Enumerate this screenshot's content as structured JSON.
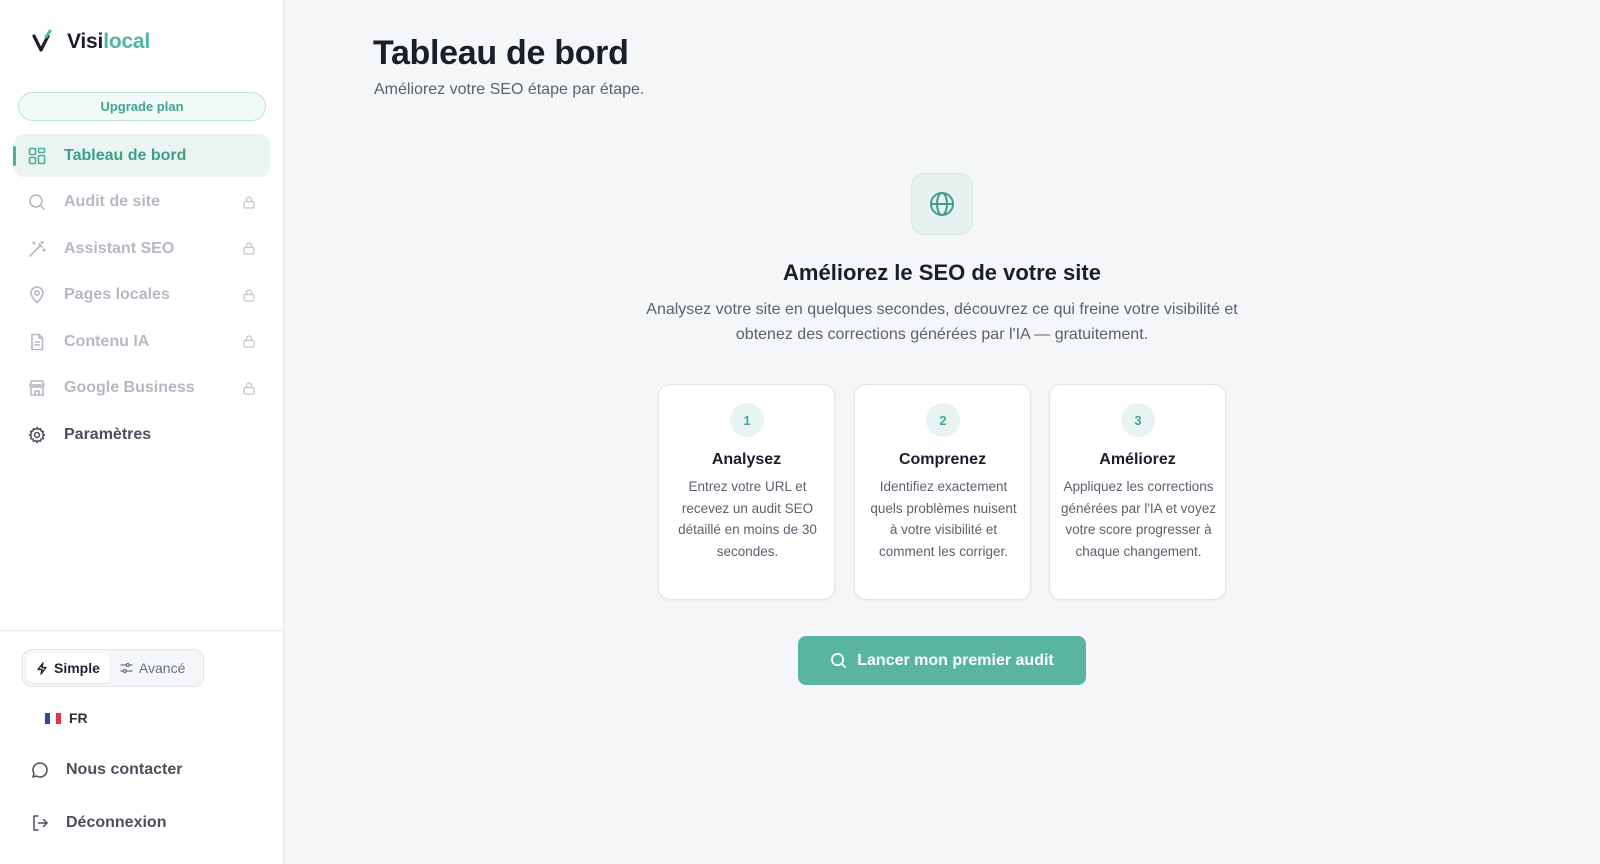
{
  "brand": {
    "name_part1": "Visi",
    "name_part2": "local",
    "accent": "#55b5a2"
  },
  "sidebar": {
    "upgrade_label": "Upgrade plan",
    "items": [
      {
        "label": "Tableau de bord",
        "icon": "dashboard-icon",
        "state": "active"
      },
      {
        "label": "Audit de site",
        "icon": "search-icon",
        "state": "locked"
      },
      {
        "label": "Assistant SEO",
        "icon": "magic-wand-icon",
        "state": "locked"
      },
      {
        "label": "Pages locales",
        "icon": "map-pin-icon",
        "state": "locked"
      },
      {
        "label": "Contenu IA",
        "icon": "document-icon",
        "state": "locked"
      },
      {
        "label": "Google Business",
        "icon": "store-icon",
        "state": "locked"
      },
      {
        "label": "Paramètres",
        "icon": "gear-icon",
        "state": "normal"
      }
    ],
    "mode": {
      "simple_label": "Simple",
      "advanced_label": "Avancé",
      "selected": "Simple"
    },
    "language": {
      "code": "FR"
    },
    "contact_label": "Nous contacter",
    "logout_label": "Déconnexion"
  },
  "main": {
    "title": "Tableau de bord",
    "subtitle": "Améliorez votre SEO étape par étape.",
    "hero": {
      "icon": "globe-icon",
      "title": "Améliorez le SEO de votre site",
      "description": "Analysez votre site en quelques secondes, découvrez ce qui freine votre visibilité et obtenez des corrections générées par l'IA — gratuitement."
    },
    "steps": [
      {
        "number": "1",
        "title": "Analysez",
        "description": "Entrez votre URL et recevez un audit SEO détaillé en moins de 30 secondes."
      },
      {
        "number": "2",
        "title": "Comprenez",
        "description": "Identifiez exactement quels problèmes nuisent à votre visibilité et comment les corriger."
      },
      {
        "number": "3",
        "title": "Améliorez",
        "description": "Appliquez les corrections générées par l'IA et voyez votre score progresser à chaque changement."
      }
    ],
    "cta_label": "Lancer mon premier audit"
  }
}
